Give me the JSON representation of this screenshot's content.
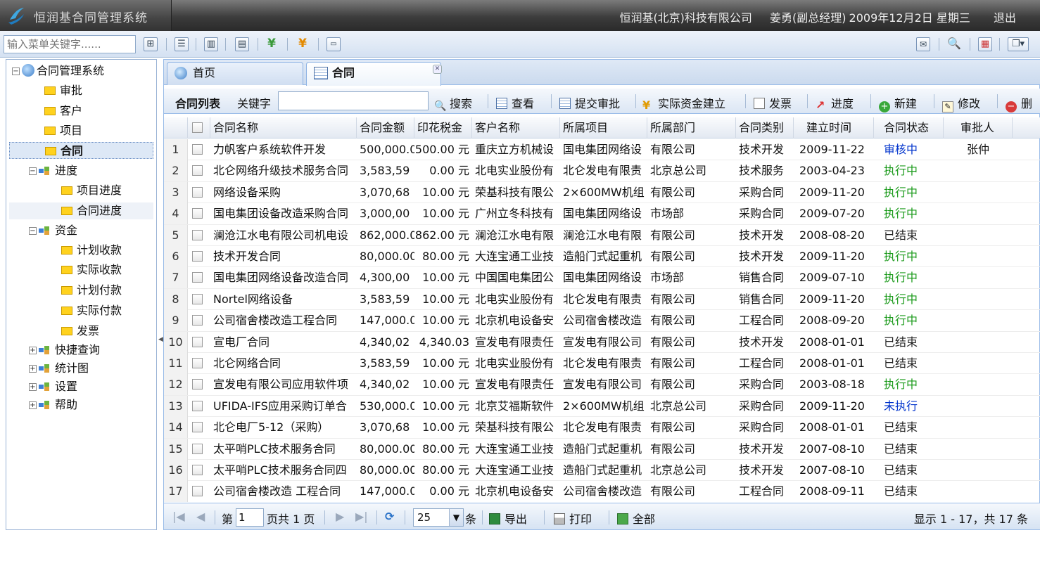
{
  "app": {
    "title": "恒润基合同管理系统",
    "company": "恒润基(北京)科技有限公司",
    "user": "姜勇(副总经理)",
    "date": "2009年12月2日 星期三",
    "logout": "退出"
  },
  "toolbar": {
    "menu_search_placeholder": "输入菜单关键字......"
  },
  "tree": {
    "root": "合同管理系统",
    "items": {
      "shenpi": "审批",
      "kehu": "客户",
      "xiangmu": "项目",
      "hetong": "合同",
      "jindu": "进度",
      "xiangmu_jindu": "项目进度",
      "hetong_jindu": "合同进度",
      "zijin": "资金",
      "jihua_shoukuan": "计划收款",
      "shiji_shoukuan": "实际收款",
      "jihua_fukuan": "计划付款",
      "shiji_fukuan": "实际付款",
      "fapiao": "发票",
      "kuaijie": "快捷查询",
      "tongji": "统计图",
      "shezhi": "设置",
      "bangzhu": "帮助"
    }
  },
  "tabs": {
    "home": "首页",
    "contract": "合同"
  },
  "grid_toolbar": {
    "list_title": "合同列表",
    "keyword_label": "关键字",
    "search": "搜索",
    "view": "查看",
    "submit": "提交审批",
    "funds": "实际资金建立",
    "invoice": "发票",
    "progress": "进度",
    "add": "新建",
    "edit": "修改",
    "delete": "删"
  },
  "columns": [
    "合同名称",
    "合同金额",
    "印花税金",
    "客户名称",
    "所属项目",
    "所属部门",
    "合同类别",
    "建立时间",
    "合同状态",
    "审批人"
  ],
  "rows": [
    [
      "1",
      "力帆客户系统软件开发",
      "500,000.0",
      "500.00 元",
      "重庆立方机械设",
      "国电集团网络设",
      "有限公司",
      "技术开发",
      "2009-11-22",
      "审核中",
      "张仲"
    ],
    [
      "2",
      "北仑网络升级技术服务合同",
      "3,583,59",
      "0.00 元",
      "北电实业股份有",
      "北仑发电有限责",
      "北京总公司",
      "技术服务",
      "2003-04-23",
      "执行中",
      ""
    ],
    [
      "3",
      "网络设备采购",
      "3,070,68",
      "10.00 元",
      "荣基科技有限公",
      "2×600MW机组",
      "有限公司",
      "采购合同",
      "2009-11-20",
      "执行中",
      ""
    ],
    [
      "4",
      "国电集团设备改造采购合同",
      "3,000,00",
      "10.00 元",
      "广州立冬科技有",
      "国电集团网络设",
      "市场部",
      "采购合同",
      "2009-07-20",
      "执行中",
      ""
    ],
    [
      "5",
      "澜沧江水电有限公司机电设",
      "862,000.0",
      "862.00 元",
      "澜沧江水电有限",
      "澜沧江水电有限",
      "有限公司",
      "技术开发",
      "2008-08-20",
      "已结束",
      ""
    ],
    [
      "6",
      "技术开发合同",
      "80,000.00",
      "80.00 元",
      "大连宝通工业技",
      "造船门式起重机",
      "有限公司",
      "技术开发",
      "2009-11-20",
      "执行中",
      ""
    ],
    [
      "7",
      "国电集团网络设备改造合同",
      "4,300,00",
      "10.00 元",
      "中国国电集团公",
      "国电集团网络设",
      "市场部",
      "销售合同",
      "2009-07-10",
      "执行中",
      ""
    ],
    [
      "8",
      "Nortel网络设备",
      "3,583,59",
      "10.00 元",
      "北电实业股份有",
      "北仑发电有限责",
      "有限公司",
      "销售合同",
      "2009-11-20",
      "执行中",
      ""
    ],
    [
      "9",
      "公司宿舍楼改造工程合同",
      "147,000.0",
      "10.00 元",
      "北京机电设备安",
      "公司宿舍楼改造",
      "有限公司",
      "工程合同",
      "2008-09-20",
      "执行中",
      ""
    ],
    [
      "10",
      "宣电厂合同",
      "4,340,02",
      "4,340.03",
      "宣发电有限责任",
      "宣发电有限公司",
      "有限公司",
      "技术开发",
      "2008-01-01",
      "已结束",
      ""
    ],
    [
      "11",
      "北仑网络合同",
      "3,583,59",
      "10.00 元",
      "北电实业股份有",
      "北仑发电有限责",
      "有限公司",
      "工程合同",
      "2008-01-01",
      "已结束",
      ""
    ],
    [
      "12",
      "宣发电有限公司应用软件项",
      "4,340,02",
      "10.00 元",
      "宣发电有限责任",
      "宣发电有限公司",
      "有限公司",
      "采购合同",
      "2003-08-18",
      "执行中",
      ""
    ],
    [
      "13",
      "UFIDA-IFS应用采购订单合",
      "530,000.0",
      "10.00 元",
      "北京艾福斯软件",
      "2×600MW机组",
      "北京总公司",
      "采购合同",
      "2009-11-20",
      "未执行",
      ""
    ],
    [
      "14",
      "北仑电厂5-12（采购）",
      "3,070,68",
      "10.00 元",
      "荣基科技有限公",
      "北仑发电有限责",
      "有限公司",
      "采购合同",
      "2008-01-01",
      "已结束",
      ""
    ],
    [
      "15",
      "太平哨PLC技术服务合同",
      "80,000.00",
      "80.00 元",
      "大连宝通工业技",
      "造船门式起重机",
      "有限公司",
      "技术开发",
      "2007-08-10",
      "已结束",
      ""
    ],
    [
      "16",
      "太平哨PLC技术服务合同四",
      "80,000.00",
      "80.00 元",
      "大连宝通工业技",
      "造船门式起重机",
      "北京总公司",
      "技术开发",
      "2007-08-10",
      "已结束",
      ""
    ],
    [
      "17",
      "公司宿舍楼改造 工程合同",
      "147,000.0",
      "0.00 元",
      "北京机电设备安",
      "公司宿舍楼改造",
      "有限公司",
      "工程合同",
      "2008-09-11",
      "已结束",
      ""
    ]
  ],
  "status_colors": {
    "审核中": "#0033cc",
    "执行中": "#1a9a1a",
    "未执行": "#0033cc",
    "已结束": "#222222"
  },
  "paging": {
    "page_prefix": "第",
    "page_value": "1",
    "page_suffix": "页共 1 页",
    "page_size": "25",
    "size_suffix": "条",
    "export": "导出",
    "print": "打印",
    "all": "全部",
    "summary": "显示 1 - 17，共 17 条"
  }
}
